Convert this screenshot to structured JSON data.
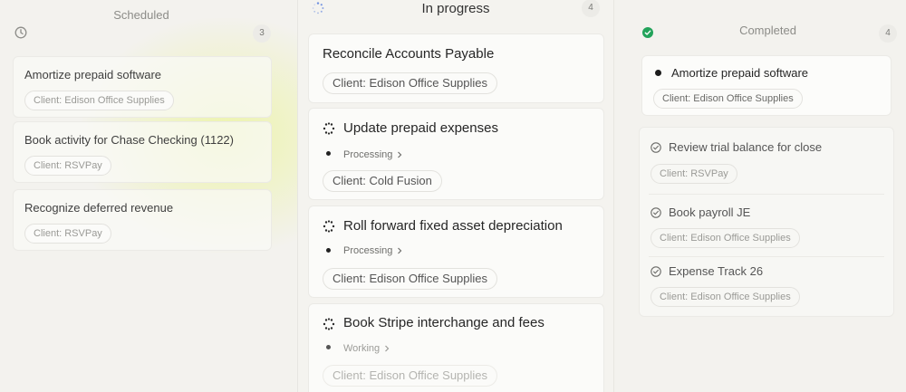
{
  "columns": {
    "scheduled": {
      "title": "Scheduled",
      "count": "3",
      "icon": "clock-icon",
      "cards": [
        {
          "title": "Amortize prepaid software",
          "client": "Client: Edison Office Supplies"
        },
        {
          "title": "Book activity for Chase Checking (1122)",
          "client": "Client: RSVPay"
        },
        {
          "title": "Recognize deferred revenue",
          "client": "Client: RSVPay"
        }
      ]
    },
    "in_progress": {
      "title": "In progress",
      "count": "4",
      "icon": "loading-spinner-icon",
      "cards": [
        {
          "title": "Reconcile Accounts Payable",
          "client": "Client: Edison Office Supplies"
        },
        {
          "title": "Update prepaid expenses",
          "status": "Processing",
          "client": "Client: Cold Fusion"
        },
        {
          "title": "Roll forward fixed asset depreciation",
          "status": "Processing",
          "client": "Client: Edison Office Supplies"
        },
        {
          "title": "Book Stripe interchange and fees",
          "status": "Working",
          "client": "Client: Edison Office Supplies"
        }
      ]
    },
    "completed": {
      "title": "Completed",
      "count": "4",
      "icon": "check-circle-icon",
      "accent": "#22a35a",
      "cards": [
        {
          "title": "Amortize prepaid software",
          "client": "Client: Edison Office Supplies"
        },
        {
          "title": "Review trial balance for close",
          "client": "Client: RSVPay"
        },
        {
          "title": "Book payroll JE",
          "client": "Client: Edison Office Supplies"
        },
        {
          "title": "Expense Track 26",
          "client": "Client: Edison Office Supplies"
        }
      ]
    }
  }
}
